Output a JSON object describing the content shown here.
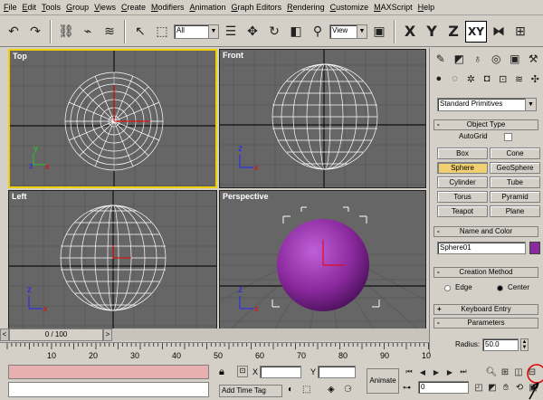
{
  "menu": [
    "File",
    "Edit",
    "Tools",
    "Group",
    "Views",
    "Create",
    "Modifiers",
    "Animation",
    "Graph Editors",
    "Rendering",
    "Customize",
    "MAXScript",
    "Help"
  ],
  "toolbar": {
    "selection_filter": "All",
    "reference_coord": "View",
    "axis_x": "X",
    "axis_y": "Y",
    "axis_z": "Z",
    "axis_xy": "XY"
  },
  "viewports": {
    "top": "Top",
    "front": "Front",
    "left": "Left",
    "perspective": "Perspective"
  },
  "command_panel": {
    "category": "Standard Primitives",
    "object_type": "Object Type",
    "autogrid": "AutoGrid",
    "primitives": [
      "Box",
      "Cone",
      "Sphere",
      "GeoSphere",
      "Cylinder",
      "Tube",
      "Torus",
      "Pyramid",
      "Teapot",
      "Plane"
    ],
    "active_primitive": "Sphere",
    "name_and_color": "Name and Color",
    "object_name": "Sphere01",
    "object_color": "#8b2a9e",
    "creation_method": "Creation Method",
    "edge": "Edge",
    "center": "Center",
    "creation_selected": "Center",
    "keyboard_entry": "Keyboard Entry",
    "parameters": "Parameters",
    "radius_label": "Radius:",
    "radius_value": "50.0"
  },
  "timeline": {
    "frame": "0 / 100",
    "ticks": [
      "10",
      "20",
      "30",
      "40",
      "50",
      "60",
      "70",
      "80",
      "90",
      "10"
    ]
  },
  "status": {
    "x_label": "X",
    "y_label": "Y",
    "animate": "Animate",
    "add_time_tag": "Add Time Tag",
    "current_frame": "0"
  },
  "colors": {
    "viewport_bg": "#666666",
    "active_border": "#f0d000",
    "sphere_purple": "#8b2a9e",
    "highlight_circle": "#e00000"
  }
}
